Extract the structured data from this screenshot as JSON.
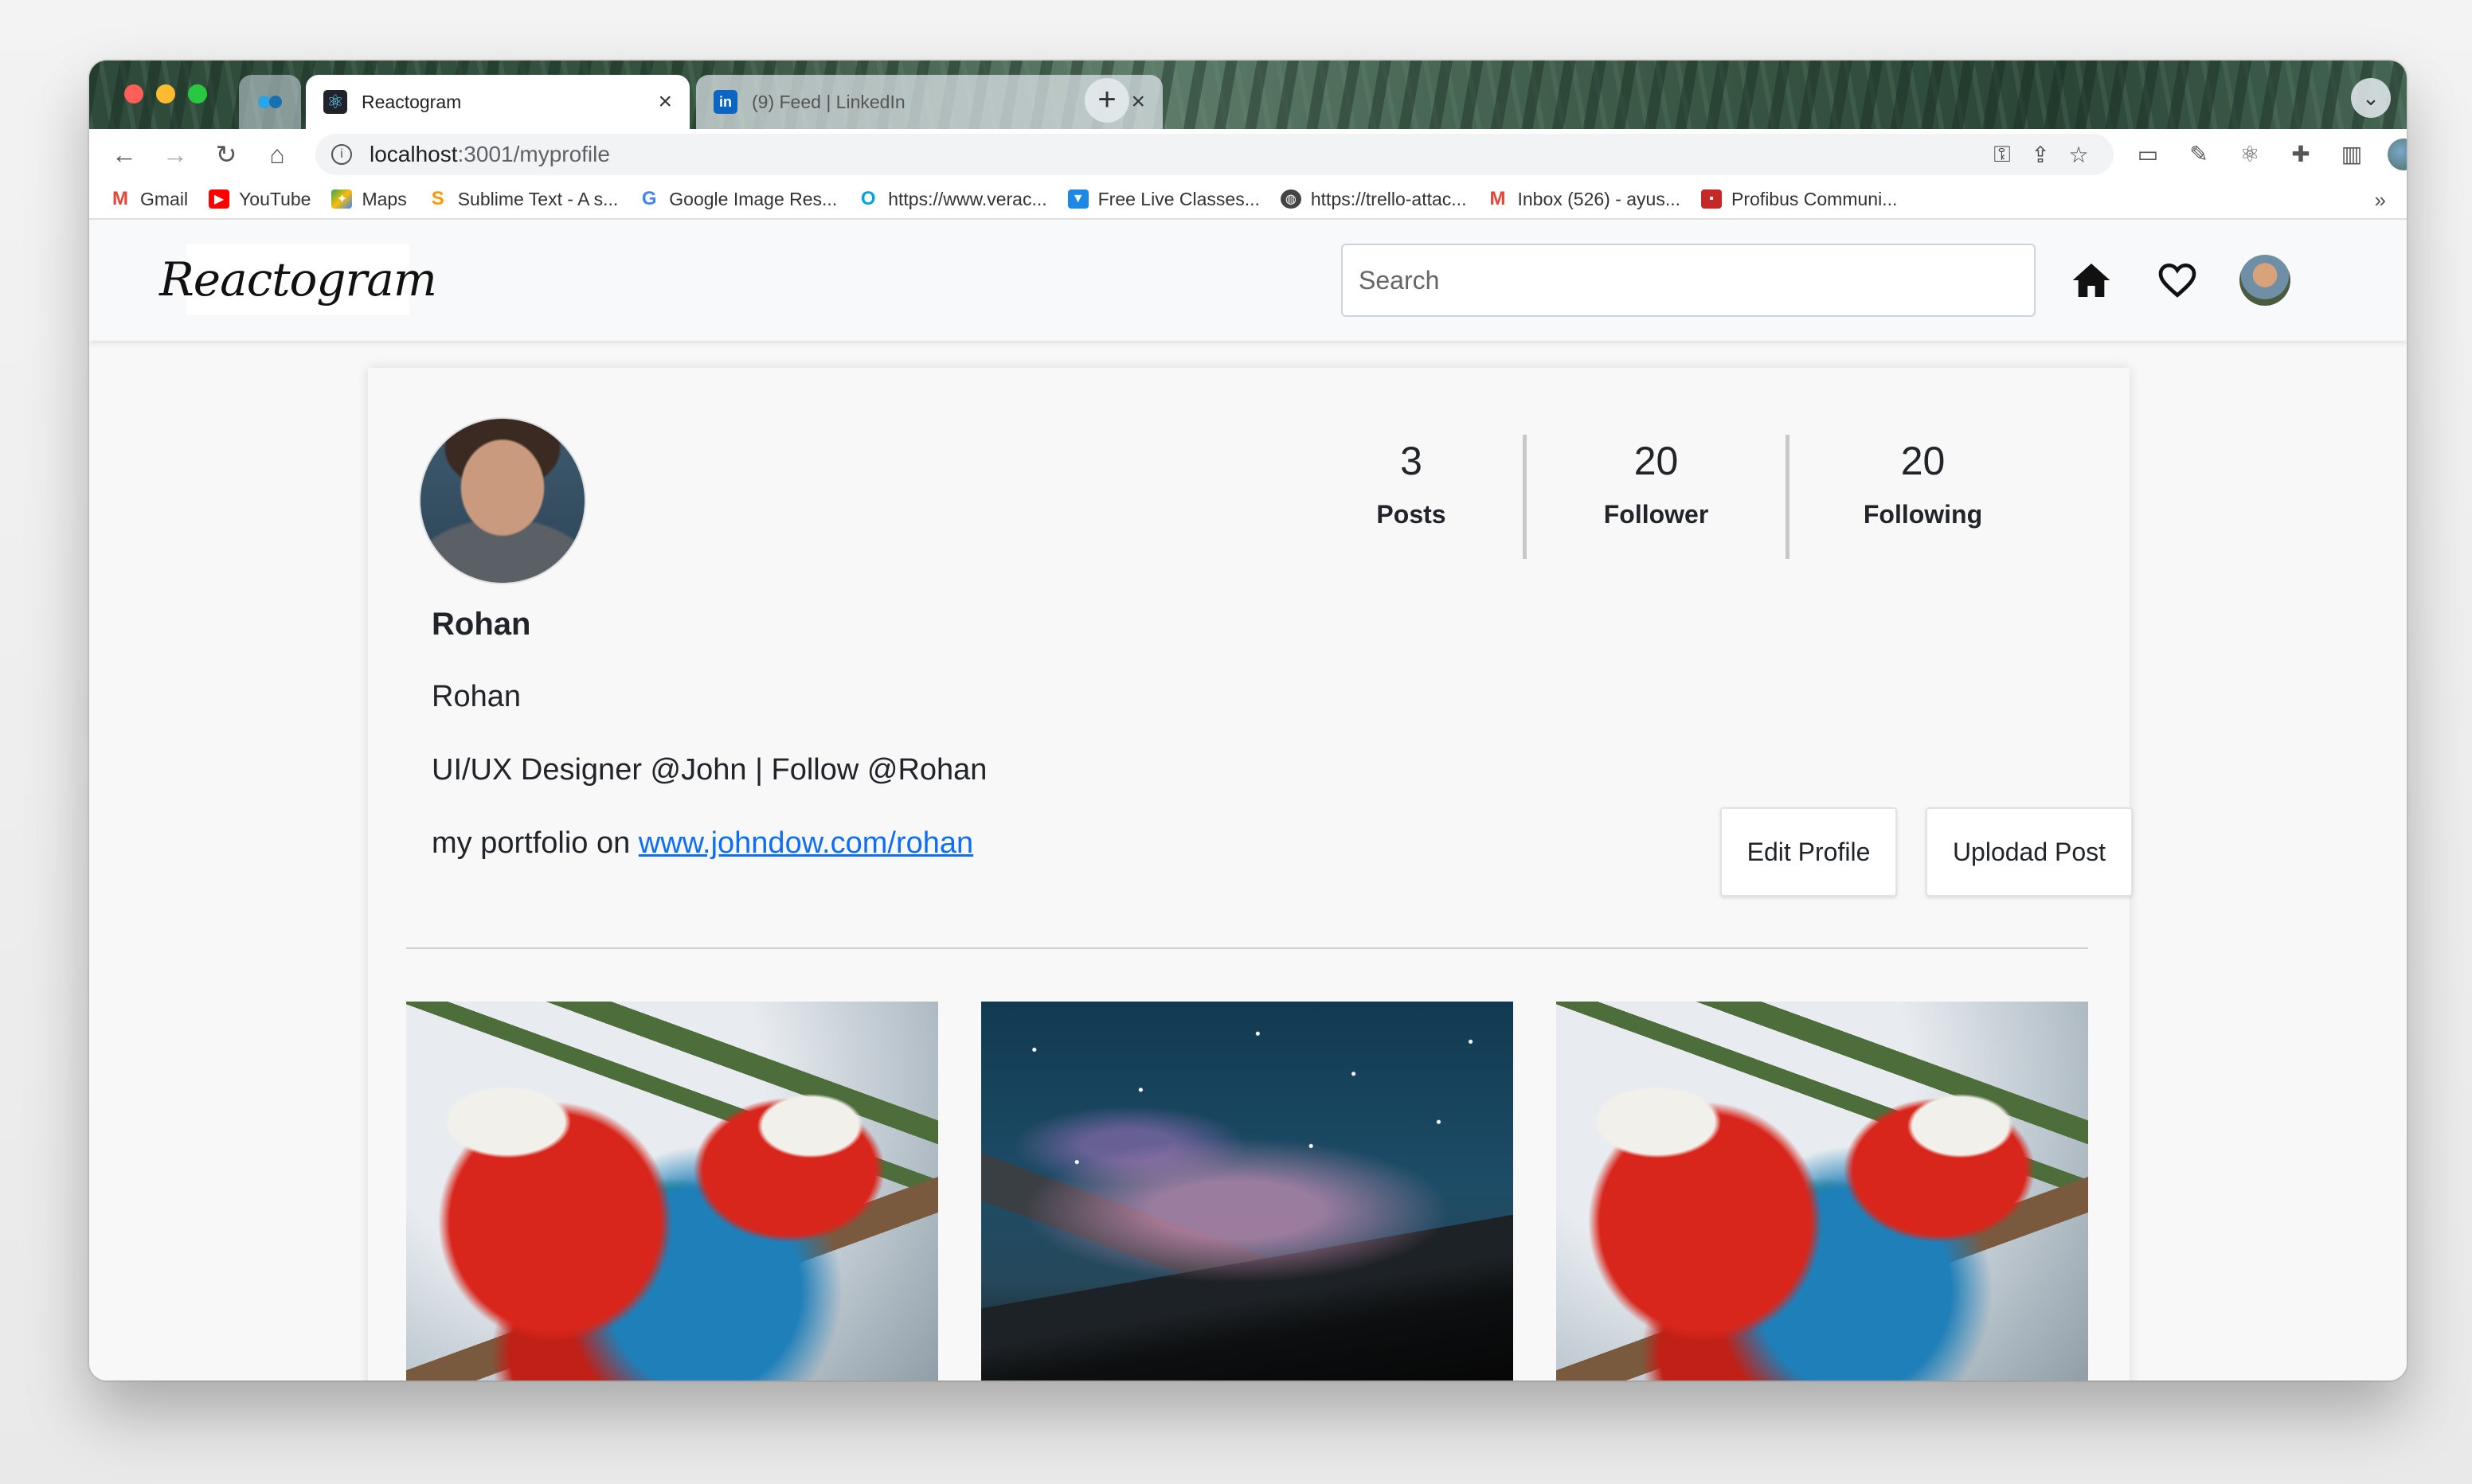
{
  "browser": {
    "tabs": [
      {
        "title": "Reactogram",
        "favicon": "react-icon",
        "active": true
      },
      {
        "title": "(9) Feed | LinkedIn",
        "favicon": "linkedin-icon",
        "active": false
      }
    ],
    "close_glyph": "×",
    "new_tab_glyph": "+",
    "url_host": "localhost",
    "url_path": ":3001/myprofile",
    "bookmarks": [
      {
        "label": "Gmail",
        "icon": "gmail-icon",
        "color": "#ea4335"
      },
      {
        "label": "YouTube",
        "icon": "youtube-icon",
        "color": "#ff0000"
      },
      {
        "label": "Maps",
        "icon": "maps-icon",
        "color": "#34a853"
      },
      {
        "label": "Sublime Text - A s...",
        "icon": "sublime-icon",
        "color": "#ff9800"
      },
      {
        "label": "Google Image Res...",
        "icon": "google-icon",
        "color": "#4285f4"
      },
      {
        "label": "https://www.verac...",
        "icon": "veracode-icon",
        "color": "#00a1e0"
      },
      {
        "label": "Free Live Classes...",
        "icon": "classes-icon",
        "color": "#1e88e5"
      },
      {
        "label": "https://trello-attac...",
        "icon": "globe-icon",
        "color": "#444444"
      },
      {
        "label": "Inbox (526) - ayus...",
        "icon": "gmail-icon",
        "color": "#ea4335"
      },
      {
        "label": "Profibus Communi...",
        "icon": "profibus-icon",
        "color": "#c62828"
      }
    ],
    "bookmarks_overflow": "»"
  },
  "app": {
    "brand": "Reactogram",
    "search_placeholder": "Search",
    "profile": {
      "username": "Rohan",
      "fullname": "Rohan",
      "bio": "UI/UX Designer @John | Follow @Rohan",
      "portfolio_prefix": "my portfolio on ",
      "portfolio_link": "www.johndow.com/rohan",
      "stats": [
        {
          "value": "3",
          "label": "Posts"
        },
        {
          "value": "20",
          "label": "Follower"
        },
        {
          "value": "20",
          "label": "Following"
        }
      ],
      "buttons": {
        "edit": "Edit Profile",
        "upload": "Uplodad Post"
      }
    },
    "posts": [
      {
        "subject": "parrots"
      },
      {
        "subject": "night-sky"
      },
      {
        "subject": "parrots"
      }
    ]
  }
}
